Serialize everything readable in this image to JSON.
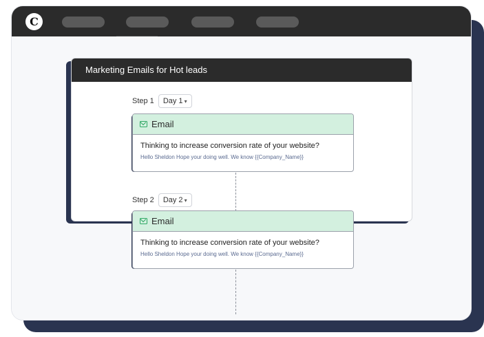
{
  "app": {
    "logo_letter": "C"
  },
  "campaign": {
    "title": "Marketing Emails for Hot leads"
  },
  "steps": [
    {
      "step_label": "Step 1",
      "day_label": "Day 1",
      "channel": "Email",
      "subject": "Thinking to increase conversion rate of your website?",
      "preview": "Hello Sheldon Hope your doing well. We know {{Company_Name}}"
    },
    {
      "step_label": "Step 2",
      "day_label": "Day 2",
      "channel": "Email",
      "subject": "Thinking to increase conversion rate of your website?",
      "preview": "Hello Sheldon Hope your doing well. We know {{Company_Name}}"
    }
  ],
  "icons": {
    "channel": "mail-icon",
    "dropdown": "chevron-down-icon"
  },
  "colors": {
    "titlebar": "#2b2b2b",
    "accent_dark": "#2a3450",
    "email_header": "#d3f0df",
    "mail_icon": "#2fa865"
  }
}
